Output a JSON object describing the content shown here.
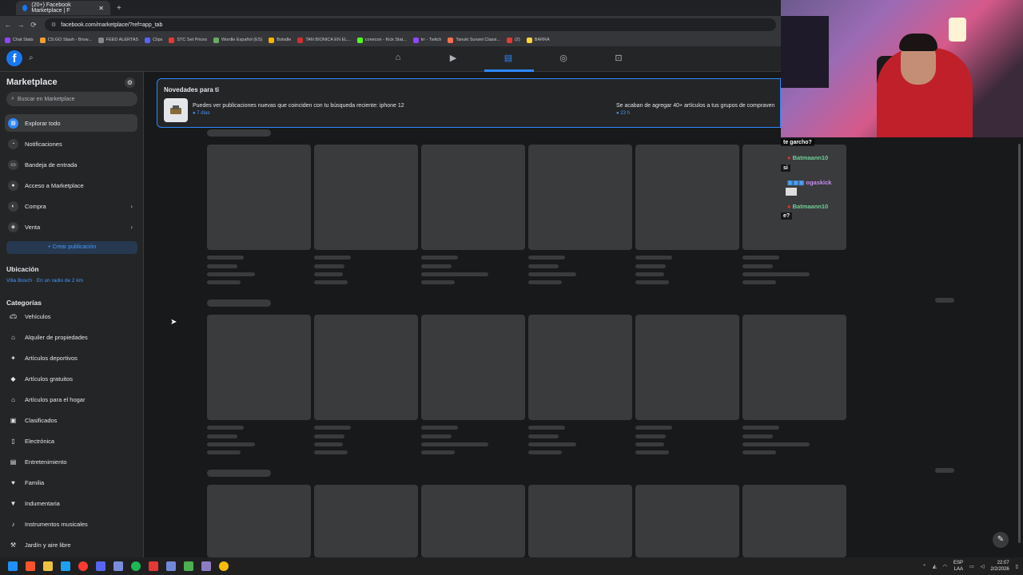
{
  "browser": {
    "tab_title": "(20+) Facebook Marketplace | F",
    "url": "facebook.com/marketplace/?ref=app_tab",
    "bookmarks": [
      "Chat Stats",
      "CS:GO Stash - Brow...",
      "FEED ALERTAS",
      "Clips",
      "STC Set Prices",
      "Wordle Español (ES)",
      "Bolsdle",
      "TAN BIONICA EN EL...",
      "conecon - Kick Stat...",
      "trr - Twitch",
      "Tanuki Sunset Classi...",
      "(2)",
      "BARRA"
    ]
  },
  "sidebar": {
    "title": "Marketplace",
    "search_placeholder": "Buscar en Marketplace",
    "nav_items": [
      {
        "label": "Explorar todo",
        "icon": "shop-icon"
      },
      {
        "label": "Notificaciones",
        "icon": "bell-icon"
      },
      {
        "label": "Bandeja de entrada",
        "icon": "inbox-icon"
      },
      {
        "label": "Acceso a Marketplace",
        "icon": "user-icon"
      },
      {
        "label": "Compra",
        "icon": "bag-icon"
      },
      {
        "label": "Venta",
        "icon": "tag-icon"
      }
    ],
    "create_button": "+ Crear publicación",
    "location_heading": "Ubicación",
    "location_value": "Villa Bosch · En un radio de 2 km",
    "categories_heading": "Categorías",
    "categories": [
      {
        "label": "Vehículos",
        "icon": "car-icon"
      },
      {
        "label": "Alquiler de propiedades",
        "icon": "house-icon"
      },
      {
        "label": "Artículos deportivos",
        "icon": "sports-icon"
      },
      {
        "label": "Artículos gratuitos",
        "icon": "free-tag-icon"
      },
      {
        "label": "Artículos para el hogar",
        "icon": "home-icon"
      },
      {
        "label": "Clasificados",
        "icon": "classifieds-icon"
      },
      {
        "label": "Electrónica",
        "icon": "phone-icon"
      },
      {
        "label": "Entretenimiento",
        "icon": "film-icon"
      },
      {
        "label": "Familia",
        "icon": "heart-icon"
      },
      {
        "label": "Indumentaria",
        "icon": "shirt-icon"
      },
      {
        "label": "Instrumentos musicales",
        "icon": "guitar-icon"
      },
      {
        "label": "Jardín y aire libre",
        "icon": "tools-icon"
      }
    ]
  },
  "notification": {
    "title": "Novedades para ti",
    "item1_text": "Puedes ver publicaciones nuevas que coinciden con tu búsqueda reciente: iphone 12",
    "item1_time": "7 días",
    "item2_text": "Se acaban de agregar 40+ artículos a tus grupos de compraven",
    "item2_time": "23 h"
  },
  "chat": {
    "line1": "te garcho?",
    "user1": "Batmaann10",
    "line2": "si",
    "user2": "ogaskick",
    "user3": "Batmaann10",
    "line3": "e?"
  },
  "taskbar": {
    "lang1": "ESP",
    "lang2": "LAA",
    "time": "22:07",
    "date": "2/2/2026"
  },
  "colors": {
    "accent": "#2d88ff",
    "background": "#18191a",
    "surface": "#242526"
  }
}
